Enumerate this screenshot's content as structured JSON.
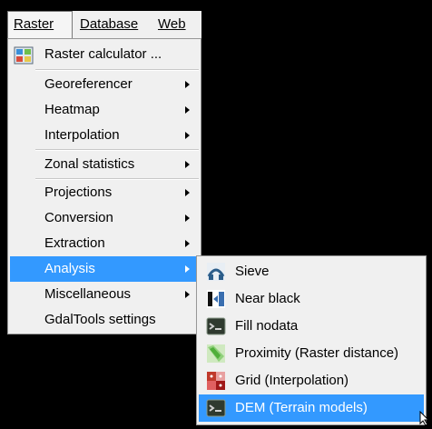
{
  "menubar": {
    "raster_label": "Raster",
    "database_label": "Database",
    "web_label": "Web"
  },
  "raster_menu": {
    "items": [
      {
        "label": "Raster calculator ...",
        "icon": "raster-calculator-icon"
      },
      {
        "label": "Georeferencer"
      },
      {
        "label": "Heatmap"
      },
      {
        "label": "Interpolation"
      },
      {
        "label": "Zonal statistics"
      },
      {
        "label": "Projections"
      },
      {
        "label": "Conversion"
      },
      {
        "label": "Extraction"
      },
      {
        "label": "Analysis"
      },
      {
        "label": "Miscellaneous"
      },
      {
        "label": "GdalTools settings"
      }
    ]
  },
  "analysis_menu": {
    "items": [
      {
        "label": "Sieve",
        "icon": "sieve-icon"
      },
      {
        "label": "Near black",
        "icon": "near-black-icon"
      },
      {
        "label": "Fill nodata",
        "icon": "fill-nodata-icon"
      },
      {
        "label": "Proximity (Raster distance)",
        "icon": "proximity-icon"
      },
      {
        "label": "Grid (Interpolation)",
        "icon": "grid-icon"
      },
      {
        "label": "DEM (Terrain models)",
        "icon": "dem-icon"
      }
    ]
  },
  "colors": {
    "highlight": "#3399ff",
    "menu_background": "#f0f0f0",
    "backdrop": "#000000"
  }
}
